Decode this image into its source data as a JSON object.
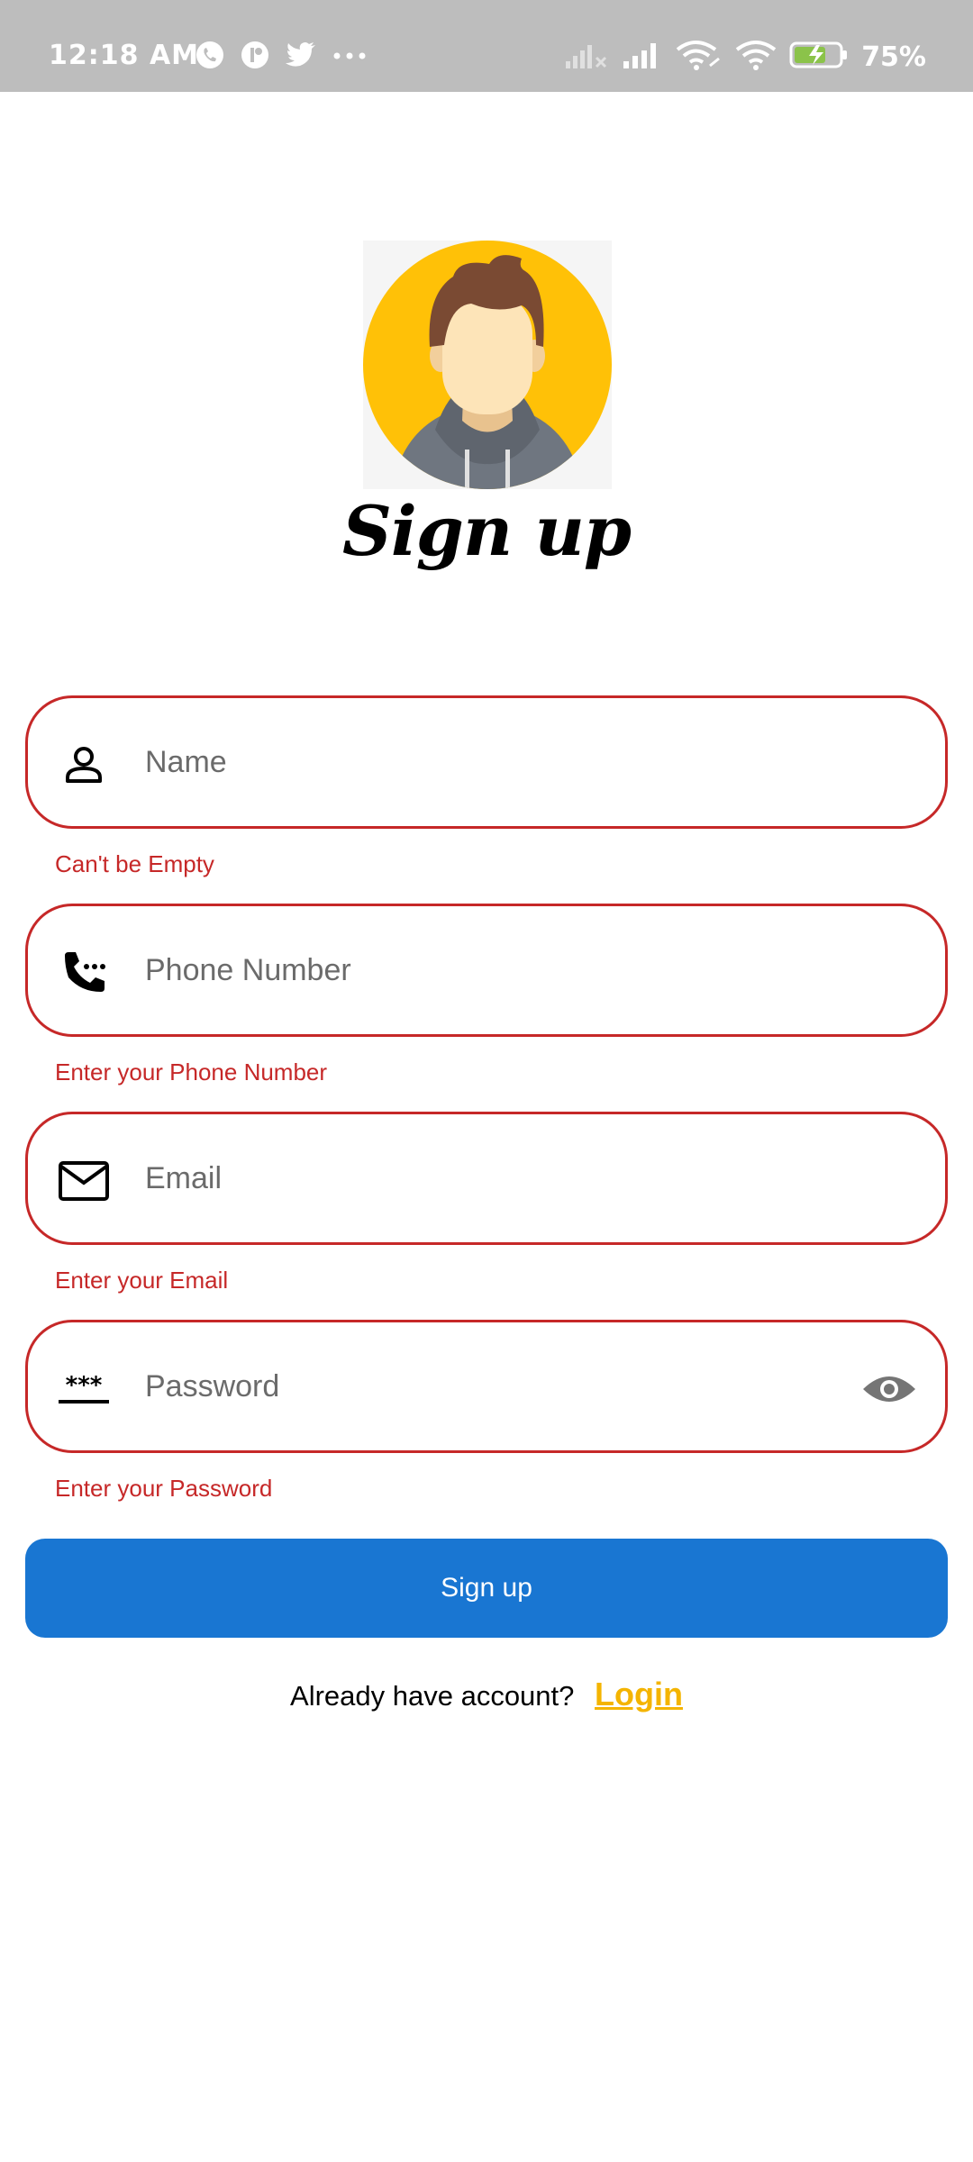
{
  "status_bar": {
    "time": "12:18 AM",
    "battery_percent": "75%",
    "left_icons": [
      "whatsapp-icon",
      "app-notification-icon",
      "twitter-icon",
      "more-dots-icon"
    ],
    "right_icons": [
      "signal-no-service-icon",
      "signal-icon",
      "wifi-link-icon",
      "wifi-icon",
      "battery-charging-icon"
    ]
  },
  "header": {
    "title": "Sign up"
  },
  "form": {
    "name": {
      "placeholder": "Name",
      "error": "Can't be Empty",
      "icon": "person-icon"
    },
    "phone": {
      "placeholder": "Phone Number",
      "error": "Enter your Phone Number",
      "icon": "phone-dialpad-icon"
    },
    "email": {
      "placeholder": "Email",
      "error": "Enter your Email",
      "icon": "mail-icon"
    },
    "password": {
      "placeholder": "Password",
      "error": "Enter your Password",
      "icon": "password-icon",
      "toggle_icon": "eye-icon"
    }
  },
  "actions": {
    "signup_label": "Sign up",
    "login_prompt": "Already have account?",
    "login_link": "Login"
  },
  "colors": {
    "error": "#c62828",
    "primary_button": "#1976d2",
    "login_link": "#f4b400",
    "status_bar": "#bdbdbd",
    "avatar_background": "#ffc107"
  }
}
